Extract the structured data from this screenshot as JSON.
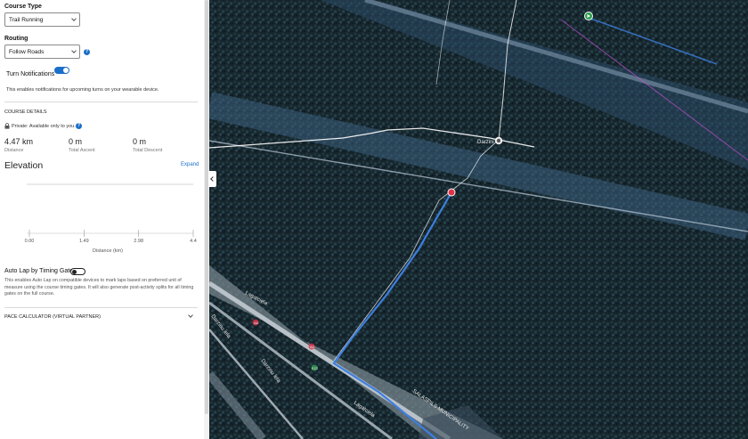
{
  "course_type": {
    "label": "Course Type",
    "value": "Trail Running"
  },
  "routing": {
    "label": "Routing",
    "value": "Follow Roads",
    "help_icon": "question-icon"
  },
  "turn_notifications": {
    "label": "Turn Notifications",
    "enabled": true,
    "description": "This enables notifications for upcoming turns on your wearable device."
  },
  "course_details": {
    "heading": "COURSE DETAILS",
    "privacy_icon": "lock-icon",
    "privacy_text": "Private: Available only to you.",
    "stats": [
      {
        "value": "4.47 km",
        "label": "Distance"
      },
      {
        "value": "0 m",
        "label": "Total Ascent"
      },
      {
        "value": "0 m",
        "label": "Total Descent"
      }
    ]
  },
  "elevation": {
    "title": "Elevation",
    "expand_label": "Expand",
    "x_ticks": [
      "0.00",
      "1.49",
      "2.98",
      "4.4"
    ],
    "xlabel": "Distance (km)"
  },
  "auto_lap": {
    "label": "Auto Lap by Timing Gates",
    "enabled": false,
    "description": "This enables Auto Lap on compatible devices to mark laps based on preferred unit of measure using the course timing gates. It will also generate post-activity splits for all timing gates on the full course."
  },
  "pace_calculator": {
    "label": "PACE CALCULATOR (VIRTUAL PARTNER)"
  },
  "map": {
    "place_labels": [
      "Darzini",
      "Lagatciela",
      "Darzinu iela",
      "SALASPILS MUNICIPALITY",
      "Lagatciela",
      "Darzinu iela"
    ],
    "road_numbers": [
      "A6",
      "A6",
      "E22"
    ],
    "colors": {
      "route": "#3d7fe0",
      "start": "#2e9e4f",
      "end": "#e0334a",
      "railway": "#c050d0"
    }
  }
}
